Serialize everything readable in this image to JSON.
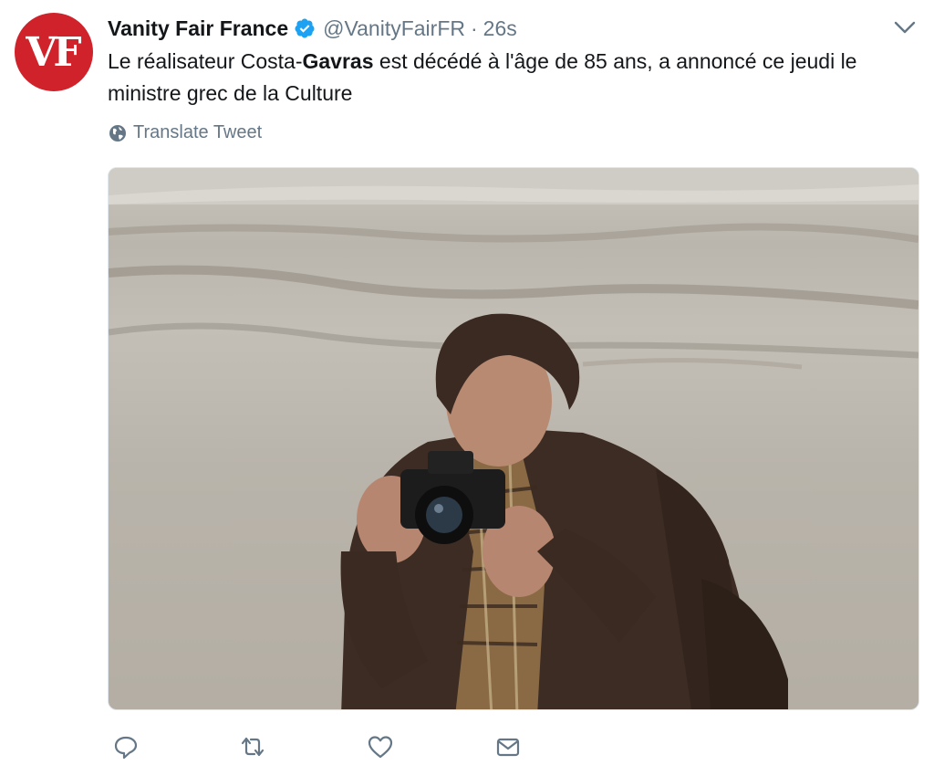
{
  "tweet": {
    "author_name": "Vanity Fair France",
    "handle": "@VanityFairFR",
    "separator": "·",
    "time": "26s",
    "avatar_text": "VF",
    "text_part1": "Le réalisateur Costa-",
    "text_bold": "Gavras",
    "text_part2": " est décédé à l'âge de 85 ans, a annoncé ce jeudi le ministre grec de la Culture",
    "translate_label": "Translate Tweet",
    "media_description_icon": "photo"
  },
  "icons": {
    "verified": "verified-badge-icon",
    "menu": "chevron-down-icon",
    "translate": "globe-icon",
    "reply": "reply-icon",
    "retweet": "retweet-icon",
    "like": "heart-icon",
    "dm": "envelope-icon"
  },
  "colors": {
    "brand_red": "#d0222a",
    "verified_blue": "#1da1f2",
    "muted": "#657786",
    "text": "#14171a"
  }
}
